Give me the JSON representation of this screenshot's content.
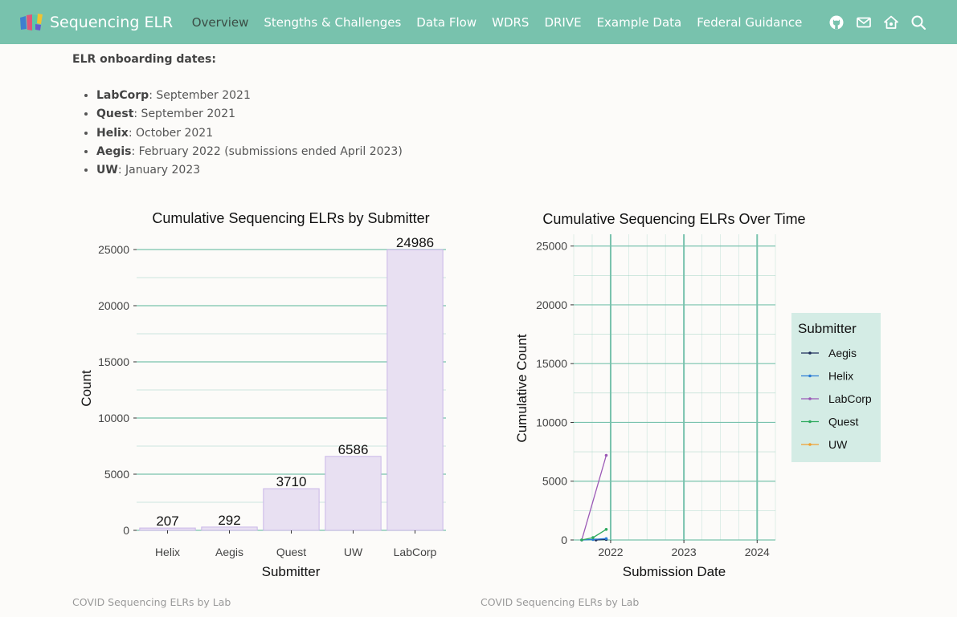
{
  "nav": {
    "brand": "Sequencing ELR",
    "links": [
      {
        "label": "Overview",
        "active": true
      },
      {
        "label": "Stengths & Challenges",
        "active": false
      },
      {
        "label": "Data Flow",
        "active": false
      },
      {
        "label": "WDRS",
        "active": false
      },
      {
        "label": "DRIVE",
        "active": false
      },
      {
        "label": "Example Data",
        "active": false
      },
      {
        "label": "Federal Guidance",
        "active": false
      }
    ],
    "icons": [
      "github-icon",
      "mail-icon",
      "home-icon",
      "search-icon"
    ],
    "accent_color": "#78c2ad",
    "active_color": "#3b4d45"
  },
  "onboarding": {
    "heading": "ELR onboarding dates:",
    "items": [
      {
        "lab": "LabCorp",
        "text": ": September 2021"
      },
      {
        "lab": "Quest",
        "text": ": September 2021"
      },
      {
        "lab": "Helix",
        "text": ": October 2021"
      },
      {
        "lab": "Aegis",
        "text": ": February 2022 (submissions ended April 2023)"
      },
      {
        "lab": "UW",
        "text": ": January 2023"
      }
    ]
  },
  "captions": {
    "left": "COVID Sequencing ELRs by Lab",
    "right": "COVID Sequencing ELRs by Lab"
  },
  "chart_data": [
    {
      "type": "bar",
      "title": "Cumulative Sequencing ELRs by Submitter",
      "xlabel": "Submitter",
      "ylabel": "Count",
      "categories": [
        "Helix",
        "Aegis",
        "Quest",
        "UW",
        "LabCorp"
      ],
      "values": [
        207,
        292,
        3710,
        6586,
        24986
      ],
      "data_labels": [
        "207",
        "292",
        "3710",
        "6586",
        "24986"
      ],
      "yticks": [
        "0",
        "5000",
        "10000",
        "15000",
        "20000",
        "25000"
      ],
      "ylim": [
        0,
        26000
      ],
      "bar_fill": "#e8e0f2",
      "bar_stroke": "#c9b6e8",
      "grid_color": "#78c2ad",
      "grid": true
    },
    {
      "type": "line",
      "title": "Cumulative Sequencing ELRs Over Time",
      "xlabel": "Submission Date",
      "ylabel": "Cumulative Count",
      "xticks": [
        "2022",
        "2023",
        "2024"
      ],
      "yticks": [
        "0",
        "5000",
        "10000",
        "15000",
        "20000",
        "25000"
      ],
      "ylim": [
        0,
        26000
      ],
      "xlim": [
        "2021-07-01",
        "2024-04-01"
      ],
      "legend_title": "Submitter",
      "legend_position": "right",
      "grid": true,
      "series": [
        {
          "name": "Aegis",
          "color": "#1f2e5a",
          "points": [
            [
              "2021-10-20",
              0
            ],
            [
              "2021-12-10",
              50
            ]
          ]
        },
        {
          "name": "Helix",
          "color": "#2b7bd6",
          "points": [
            [
              "2021-08-10",
              0
            ],
            [
              "2021-10-05",
              40
            ],
            [
              "2021-12-10",
              120
            ]
          ]
        },
        {
          "name": "LabCorp",
          "color": "#9b59b6",
          "points": [
            [
              "2021-08-10",
              0
            ],
            [
              "2021-12-10",
              7200
            ]
          ]
        },
        {
          "name": "Quest",
          "color": "#2eaa5e",
          "points": [
            [
              "2021-08-10",
              0
            ],
            [
              "2021-10-05",
              200
            ],
            [
              "2021-12-10",
              900
            ]
          ]
        },
        {
          "name": "UW",
          "color": "#f0a030",
          "points": []
        }
      ]
    }
  ]
}
